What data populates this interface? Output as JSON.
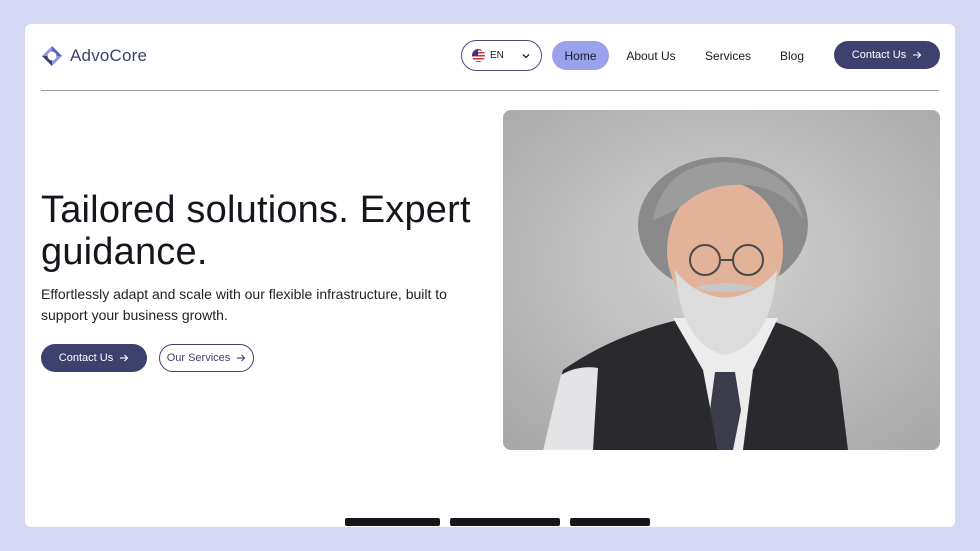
{
  "brand": {
    "name": "AdvoCore"
  },
  "language": {
    "code": "EN",
    "flag": "us-flag-icon"
  },
  "nav": {
    "home": "Home",
    "about": "About Us",
    "services": "Services",
    "blog": "Blog",
    "contact": "Contact Us"
  },
  "hero": {
    "title": "Tailored solutions. Expert guidance.",
    "subtitle": "Effortlessly adapt and scale with our flexible infrastructure, built to support your business growth.",
    "primary_cta": "Contact Us",
    "secondary_cta": "Our Services"
  },
  "colors": {
    "page_bg": "#d4d8f5",
    "accent": "#3e416e",
    "nav_active": "#9aa2ee"
  },
  "icons": {
    "logo": "logo-mark-icon",
    "arrow": "arrow-right-icon",
    "chevron": "chevron-down-icon"
  }
}
